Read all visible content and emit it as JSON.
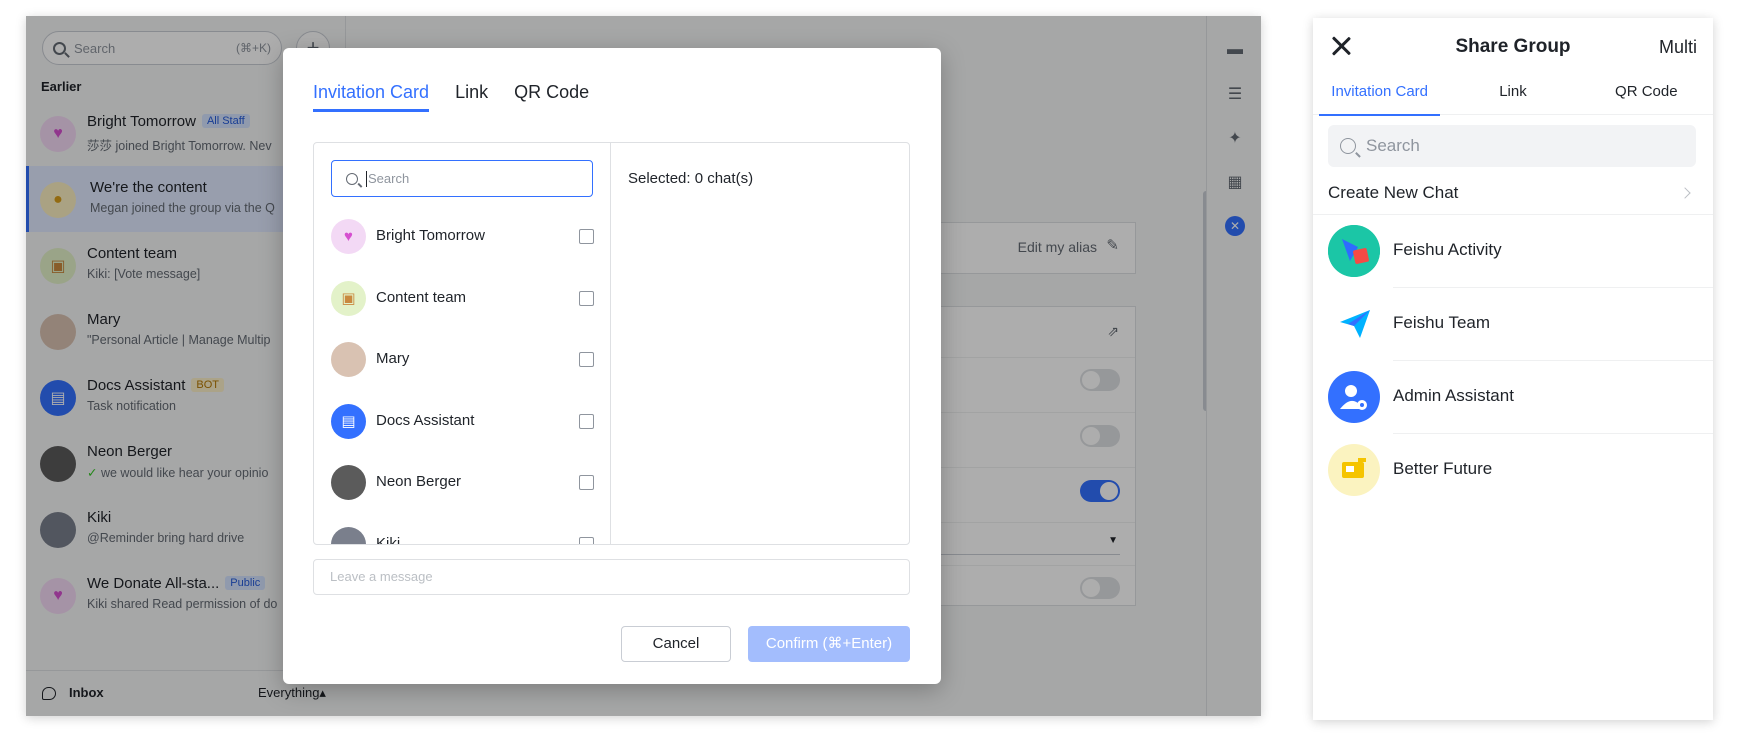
{
  "sidebar": {
    "search_placeholder": "Search",
    "search_shortcut": "(⌘+K)",
    "plus": "+",
    "section": "Earlier",
    "chats": [
      {
        "name": "Bright Tomorrow",
        "badge": "All Staff",
        "preview": "莎莎 joined Bright Tomorrow. Nev"
      },
      {
        "name": "We're the content",
        "badge": "",
        "preview": "Megan joined the group via the Q"
      },
      {
        "name": "Content team",
        "badge": "",
        "preview": "Kiki: [Vote message]"
      },
      {
        "name": "Mary",
        "badge": "",
        "preview": "\"Personal Article | Manage Multip"
      },
      {
        "name": "Docs Assistant",
        "badge": "BOT",
        "preview": "Task notification"
      },
      {
        "name": "Neon Berger",
        "badge": "",
        "preview": "we would like hear your opinio"
      },
      {
        "name": "Kiki",
        "badge": "",
        "preview": "@Reminder bring hard drive"
      },
      {
        "name": "We Donate All-sta...",
        "badge": "Public",
        "preview": "Kiki shared Read permission of do"
      }
    ],
    "bottom": {
      "inbox": "Inbox",
      "filter": "Everything▴"
    }
  },
  "main": {
    "edit_alias": "Edit my alias",
    "dropdown_value": "off"
  },
  "modal": {
    "tabs": [
      "Invitation Card",
      "Link",
      "QR Code"
    ],
    "search_placeholder": "Search",
    "contacts": [
      "Bright Tomorrow",
      "Content team",
      "Mary",
      "Docs Assistant",
      "Neon Berger",
      "Kiki"
    ],
    "selected_text": "Selected: 0 chat(s)",
    "message_placeholder": "Leave a message",
    "cancel": "Cancel",
    "confirm": "Confirm (⌘+Enter)"
  },
  "mobile": {
    "title": "Share Group",
    "multi": "Multi",
    "tabs": [
      "Invitation Card",
      "Link",
      "QR Code"
    ],
    "search_placeholder": "Search",
    "create_new_chat": "Create New Chat",
    "chats": [
      "Feishu Activity",
      "Feishu Team",
      "Admin Assistant",
      "Better Future"
    ]
  },
  "colors": {
    "accent": "#3370ff",
    "confirm_disabled": "#a3bdfd"
  }
}
